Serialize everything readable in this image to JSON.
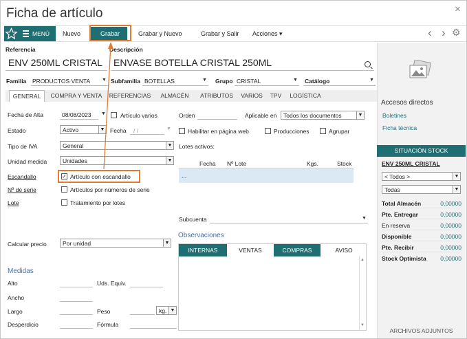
{
  "window": {
    "title": "Ficha de artículo",
    "close": "×"
  },
  "toolbar": {
    "menu": "MENÚ",
    "nuevo": "Nuevo",
    "grabar": "Grabar",
    "grabar_nuevo": "Grabar y Nuevo",
    "grabar_salir": "Grabar y Salir",
    "acciones": "Acciones ▾",
    "prev": "‹",
    "next": "›"
  },
  "header": {
    "referencia_label": "Referencia",
    "referencia_value": "ENV 250ML CRISTAL",
    "descripcion_label": "Descripción",
    "descripcion_value": "ENVASE BOTELLA CRISTAL 250ML"
  },
  "family_row": {
    "familia_label": "Familia",
    "familia_value": "PRODUCTOS VENTA",
    "subfamilia_label": "Subfamilia",
    "subfamilia_value": "BOTELLAS",
    "grupo_label": "Grupo",
    "grupo_value": "CRISTAL",
    "catalogo_label": "Catálogo",
    "catalogo_value": ""
  },
  "tabs": [
    "GENERAL",
    "COMPRA Y VENTA",
    "REFERENCIAS",
    "ALMACÉN",
    "ATRIBUTOS",
    "VARIOS",
    "TPV",
    "LOGÍSTICA"
  ],
  "general": {
    "fecha_alta_label": "Fecha de Alta",
    "fecha_alta_value": "08/08/2023",
    "articulo_varios": "Artículo varios",
    "estado_label": "Estado",
    "estado_value": "Activo",
    "fecha_label": "Fecha",
    "fecha_value": "/ /",
    "tipo_iva_label": "Tipo de IVA",
    "tipo_iva_value": "General",
    "unidad_medida_label": "Unidad medida",
    "unidad_medida_value": "Unidades",
    "escandallo_label": "Escandallo",
    "escandallo_check": "Artículo con escandallo",
    "nseries_label": "Nº de serie",
    "nseries_check": "Artículos por números de serie",
    "lote_label": "Lote",
    "lote_check": "Tratamiento por lotes",
    "calcular_precio_label": "Calcular precio",
    "calcular_precio_value": "Por unidad"
  },
  "middle": {
    "orden_label": "Orden",
    "aplicable_label": "Aplicable en",
    "aplicable_value": "Todos los documentos",
    "habilitar_web": "Habilitar en página web",
    "producciones": "Producciones",
    "agrupar": "Agrupar",
    "lotes_activos_label": "Lotes activos:",
    "lotes_cols": [
      "Fecha",
      "Nº Lote",
      "Kgs.",
      "Stock"
    ],
    "lotes_row": "...",
    "subcuenta_label": "Subcuenta"
  },
  "observaciones": {
    "title": "Observaciones",
    "tabs": [
      "INTERNAS",
      "VENTAS",
      "COMPRAS",
      "AVISO"
    ]
  },
  "medidas": {
    "title": "Medidas",
    "alto": "Alto",
    "uds_equiv": "Uds. Equiv.",
    "ancho": "Ancho",
    "largo": "Largo",
    "peso": "Peso",
    "peso_unit": "kg.",
    "desperdicio": "Desperdicio",
    "formula": "Fórmula"
  },
  "right_panel": {
    "accesos_title": "Accesos directos",
    "links": [
      "Boletines",
      "Ficha técnica"
    ],
    "stock_title": "SITUACIÓN STOCK",
    "stock_item": "ENV 250ML CRISTAL",
    "filter1": "< Todos >",
    "filter2": "Todas",
    "stock_rows": [
      {
        "label": "Total Almacén",
        "value": "0,00000"
      },
      {
        "label": "Pte. Entregar",
        "value": "0,00000"
      },
      {
        "label": "En reserva",
        "value": "0,00000"
      },
      {
        "label": "Disponible",
        "value": "0,00000"
      },
      {
        "label": "Pte. Recibir",
        "value": "0,00000"
      },
      {
        "label": "Stock Optimista",
        "value": "0,00000"
      }
    ],
    "archivos": "ARCHIVOS ADJUNTOS"
  },
  "colors": {
    "teal": "#1f6f72",
    "highlight": "#e07b33",
    "link": "#1f6f7a"
  }
}
